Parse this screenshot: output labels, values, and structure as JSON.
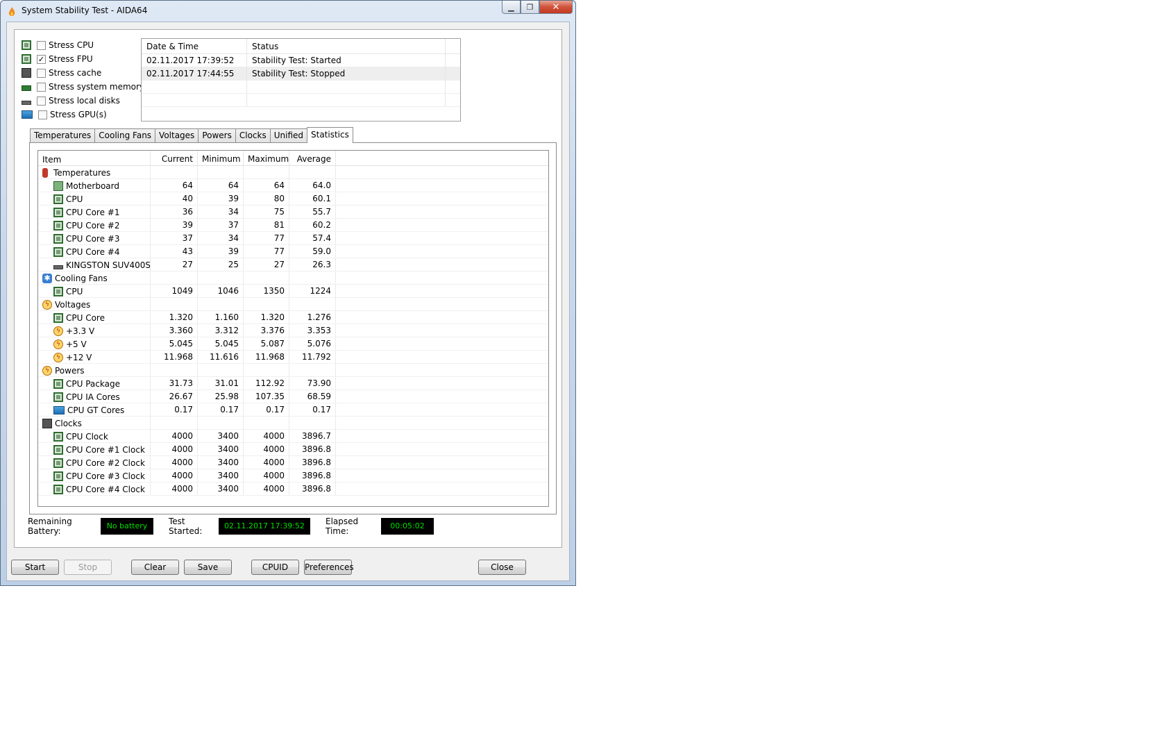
{
  "window": {
    "title": "System Stability Test - AIDA64"
  },
  "stress_options": [
    {
      "label": "Stress CPU",
      "checked": false,
      "icon": "cpu-chip-icon"
    },
    {
      "label": "Stress FPU",
      "checked": true,
      "icon": "fpu-chip-icon"
    },
    {
      "label": "Stress cache",
      "checked": false,
      "icon": "cache-icon"
    },
    {
      "label": "Stress system memory",
      "checked": false,
      "icon": "memory-icon"
    },
    {
      "label": "Stress local disks",
      "checked": false,
      "icon": "disk-icon"
    },
    {
      "label": "Stress GPU(s)",
      "checked": false,
      "icon": "gpu-icon"
    }
  ],
  "log": {
    "columns": [
      "Date & Time",
      "Status"
    ],
    "rows": [
      [
        "02.11.2017 17:39:52",
        "Stability Test: Started"
      ],
      [
        "02.11.2017 17:44:55",
        "Stability Test: Stopped"
      ]
    ]
  },
  "tabs": [
    "Temperatures",
    "Cooling Fans",
    "Voltages",
    "Powers",
    "Clocks",
    "Unified",
    "Statistics"
  ],
  "active_tab": "Statistics",
  "stats": {
    "columns": [
      "Item",
      "Current",
      "Minimum",
      "Maximum",
      "Average"
    ],
    "rows": [
      {
        "type": "group",
        "icon": "temperature-icon",
        "label": "Temperatures"
      },
      {
        "type": "item",
        "icon": "motherboard-icon",
        "label": "Motherboard",
        "cur": "64",
        "min": "64",
        "max": "64",
        "avg": "64.0"
      },
      {
        "type": "item",
        "icon": "cpu-chip-icon",
        "label": "CPU",
        "cur": "40",
        "min": "39",
        "max": "80",
        "avg": "60.1"
      },
      {
        "type": "item",
        "icon": "cpu-chip-icon",
        "label": "CPU Core #1",
        "cur": "36",
        "min": "34",
        "max": "75",
        "avg": "55.7"
      },
      {
        "type": "item",
        "icon": "cpu-chip-icon",
        "label": "CPU Core #2",
        "cur": "39",
        "min": "37",
        "max": "81",
        "avg": "60.2"
      },
      {
        "type": "item",
        "icon": "cpu-chip-icon",
        "label": "CPU Core #3",
        "cur": "37",
        "min": "34",
        "max": "77",
        "avg": "57.4"
      },
      {
        "type": "item",
        "icon": "cpu-chip-icon",
        "label": "CPU Core #4",
        "cur": "43",
        "min": "39",
        "max": "77",
        "avg": "59.0"
      },
      {
        "type": "item",
        "icon": "disk-icon",
        "label": "KINGSTON SUV400S...",
        "cur": "27",
        "min": "25",
        "max": "27",
        "avg": "26.3"
      },
      {
        "type": "group",
        "icon": "fan-icon",
        "label": "Cooling Fans"
      },
      {
        "type": "item",
        "icon": "cpu-chip-icon",
        "label": "CPU",
        "cur": "1049",
        "min": "1046",
        "max": "1350",
        "avg": "1224"
      },
      {
        "type": "group",
        "icon": "voltage-icon",
        "label": "Voltages"
      },
      {
        "type": "item",
        "icon": "cpu-chip-icon",
        "label": "CPU Core",
        "cur": "1.320",
        "min": "1.160",
        "max": "1.320",
        "avg": "1.276"
      },
      {
        "type": "item",
        "icon": "voltage-icon",
        "label": "+3.3 V",
        "cur": "3.360",
        "min": "3.312",
        "max": "3.376",
        "avg": "3.353"
      },
      {
        "type": "item",
        "icon": "voltage-icon",
        "label": "+5 V",
        "cur": "5.045",
        "min": "5.045",
        "max": "5.087",
        "avg": "5.076"
      },
      {
        "type": "item",
        "icon": "voltage-icon",
        "label": "+12 V",
        "cur": "11.968",
        "min": "11.616",
        "max": "11.968",
        "avg": "11.792"
      },
      {
        "type": "group",
        "icon": "power-icon",
        "label": "Powers"
      },
      {
        "type": "item",
        "icon": "cpu-chip-icon",
        "label": "CPU Package",
        "cur": "31.73",
        "min": "31.01",
        "max": "112.92",
        "avg": "73.90"
      },
      {
        "type": "item",
        "icon": "cpu-chip-icon",
        "label": "CPU IA Cores",
        "cur": "26.67",
        "min": "25.98",
        "max": "107.35",
        "avg": "68.59"
      },
      {
        "type": "item",
        "icon": "gpu-icon",
        "label": "CPU GT Cores",
        "cur": "0.17",
        "min": "0.17",
        "max": "0.17",
        "avg": "0.17"
      },
      {
        "type": "group",
        "icon": "clock-icon",
        "label": "Clocks"
      },
      {
        "type": "item",
        "icon": "cpu-chip-icon",
        "label": "CPU Clock",
        "cur": "4000",
        "min": "3400",
        "max": "4000",
        "avg": "3896.7"
      },
      {
        "type": "item",
        "icon": "cpu-chip-icon",
        "label": "CPU Core #1 Clock",
        "cur": "4000",
        "min": "3400",
        "max": "4000",
        "avg": "3896.8"
      },
      {
        "type": "item",
        "icon": "cpu-chip-icon",
        "label": "CPU Core #2 Clock",
        "cur": "4000",
        "min": "3400",
        "max": "4000",
        "avg": "3896.8"
      },
      {
        "type": "item",
        "icon": "cpu-chip-icon",
        "label": "CPU Core #3 Clock",
        "cur": "4000",
        "min": "3400",
        "max": "4000",
        "avg": "3896.8"
      },
      {
        "type": "item",
        "icon": "cpu-chip-icon",
        "label": "CPU Core #4 Clock",
        "cur": "4000",
        "min": "3400",
        "max": "4000",
        "avg": "3896.8"
      }
    ]
  },
  "status": {
    "battery_label": "Remaining Battery:",
    "battery_value": "No battery",
    "started_label": "Test Started:",
    "started_value": "02.11.2017 17:39:52",
    "elapsed_label": "Elapsed Time:",
    "elapsed_value": "00:05:02"
  },
  "buttons": {
    "start": "Start",
    "stop": "Stop",
    "clear": "Clear",
    "save": "Save",
    "cpuid": "CPUID",
    "preferences": "Preferences",
    "close": "Close"
  },
  "colors": {
    "lcd_bg": "#000000",
    "lcd_text": "#00e000"
  }
}
